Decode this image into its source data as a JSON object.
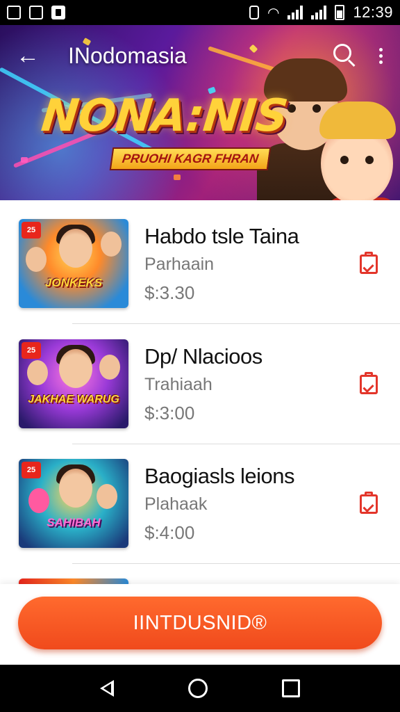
{
  "status_bar": {
    "time": "12:39",
    "icons": [
      "gmail-icon",
      "app-icon",
      "square-app-icon",
      "vibrate-icon",
      "wifi-icon",
      "signal-icon",
      "signal-icon-2",
      "battery-icon"
    ]
  },
  "app_bar": {
    "title": "INodomasia",
    "back_icon": "arrow-left-icon",
    "search_icon": "search-icon",
    "menu_icon": "more-vert-icon"
  },
  "hero": {
    "logo_text": "NONA:NIS",
    "subtitle": "PRUOHI KAGR FHRAN"
  },
  "games": [
    {
      "title": "Habdo tsle Taina",
      "subtitle": "Parhaain",
      "price": "$:3.30",
      "thumb_logo": "JONKEKS",
      "thumb_badge": "25",
      "action_icon": "clipboard-check-icon"
    },
    {
      "title": "Dp/ Nlacioos",
      "subtitle": "Trahiaah",
      "price": "$:3:00",
      "thumb_logo": "JAKHAE WARUG",
      "thumb_badge": "25",
      "action_icon": "clipboard-check-icon"
    },
    {
      "title": "Baogiasls leions",
      "subtitle": "Plahaak",
      "price": "$:4:00",
      "thumb_logo": "SAHIBAH",
      "thumb_badge": "25",
      "action_icon": "clipboard-check-icon"
    }
  ],
  "cta": {
    "label": "IINTDUSNID®"
  },
  "colors": {
    "accent": "#f04a1c",
    "icon_red": "#e3352a",
    "title_text": "#111111",
    "secondary_text": "#777777"
  },
  "nav_bar": {
    "icons": [
      "nav-back-icon",
      "nav-home-icon",
      "nav-recents-icon"
    ]
  }
}
